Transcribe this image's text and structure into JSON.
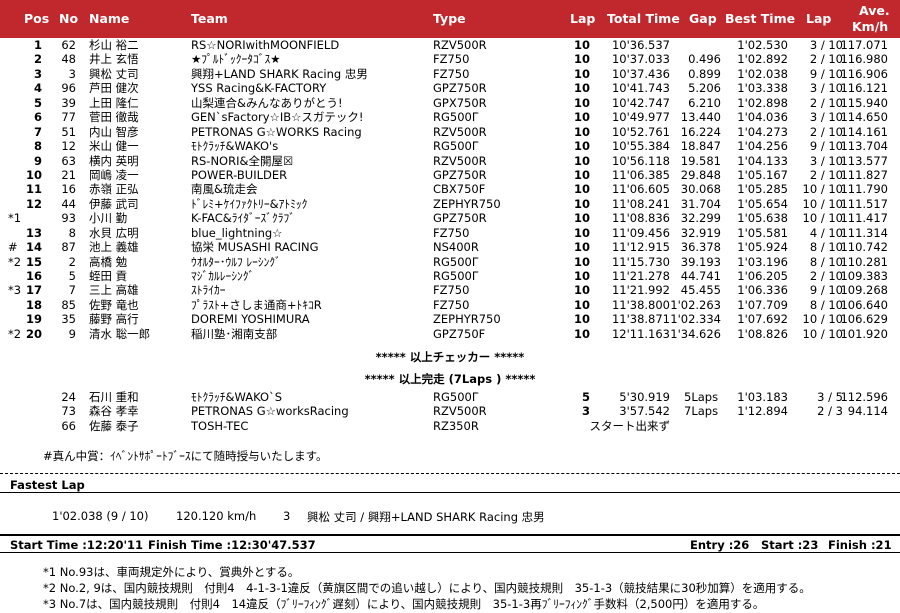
{
  "header": {
    "pos": "Pos",
    "no": "No",
    "name": "Name",
    "team": "Team",
    "type": "Type",
    "lap": "Lap",
    "total_time": "Total Time",
    "gap": "Gap",
    "best_time": "Best Time",
    "best_lap": "Lap",
    "ave_line1": "Ave.",
    "ave_line2": "Km/h"
  },
  "results": [
    {
      "mark": "",
      "pos": "1",
      "no": "62",
      "name": "杉山 裕二",
      "team": "RS☆NORIwithMOONFIELD",
      "type": "RZV500R",
      "lap": "10",
      "total": "10'36.537",
      "gap": "",
      "best": "1'02.530",
      "blap": "3 / 10",
      "ave": "117.071"
    },
    {
      "mark": "",
      "pos": "2",
      "no": "48",
      "name": "井上 玄悟",
      "team": "★ﾌﾟﾙﾄﾞｯｸｰﾀｺﾞｽ★",
      "type": "FZ750",
      "lap": "10",
      "total": "10'37.033",
      "gap": "0.496",
      "best": "1'02.892",
      "blap": "2 / 10",
      "ave": "116.980"
    },
    {
      "mark": "",
      "pos": "3",
      "no": "3",
      "name": "興松 丈司",
      "team": "興翔+LAND SHARK Racing 忠男",
      "type": "FZ750",
      "lap": "10",
      "total": "10'37.436",
      "gap": "0.899",
      "best": "1'02.038",
      "blap": "9 / 10",
      "ave": "116.906"
    },
    {
      "mark": "",
      "pos": "4",
      "no": "96",
      "name": "芦田 健次",
      "team": "YSS Racing&K-FACTORY",
      "type": "GPZ750R",
      "lap": "10",
      "total": "10'41.743",
      "gap": "5.206",
      "best": "1'03.338",
      "blap": "3 / 10",
      "ave": "116.121"
    },
    {
      "mark": "",
      "pos": "5",
      "no": "39",
      "name": "上田 隆仁",
      "team": "山梨連合&みんなありがとう!",
      "type": "GPX750R",
      "lap": "10",
      "total": "10'42.747",
      "gap": "6.210",
      "best": "1'02.898",
      "blap": "2 / 10",
      "ave": "115.940"
    },
    {
      "mark": "",
      "pos": "6",
      "no": "77",
      "name": "菅田 徹哉",
      "team": "GEN`sFactory☆IB☆スガテック!",
      "type": "RG500Γ",
      "lap": "10",
      "total": "10'49.977",
      "gap": "13.440",
      "best": "1'04.036",
      "blap": "3 / 10",
      "ave": "114.650"
    },
    {
      "mark": "",
      "pos": "7",
      "no": "51",
      "name": "内山 智彦",
      "team": "PETRONAS G☆WORKS Racing",
      "type": "RZV500R",
      "lap": "10",
      "total": "10'52.761",
      "gap": "16.224",
      "best": "1'04.273",
      "blap": "2 / 10",
      "ave": "114.161"
    },
    {
      "mark": "",
      "pos": "8",
      "no": "12",
      "name": "米山 健一",
      "team": "ﾓﾄｸﾗｯﾁ&WAKO's",
      "type": "RG500Γ",
      "lap": "10",
      "total": "10'55.384",
      "gap": "18.847",
      "best": "1'04.256",
      "blap": "9 / 10",
      "ave": "113.704"
    },
    {
      "mark": "",
      "pos": "9",
      "no": "63",
      "name": "横内 英明",
      "team": "RS-NORI&全開屋☒",
      "type": "RZV500R",
      "lap": "10",
      "total": "10'56.118",
      "gap": "19.581",
      "best": "1'04.133",
      "blap": "3 / 10",
      "ave": "113.577"
    },
    {
      "mark": "",
      "pos": "10",
      "no": "21",
      "name": "岡嶋 凌一",
      "team": "POWER-BUILDER",
      "type": "GPZ750R",
      "lap": "10",
      "total": "11'06.385",
      "gap": "29.848",
      "best": "1'05.167",
      "blap": "2 / 10",
      "ave": "111.827"
    },
    {
      "mark": "",
      "pos": "11",
      "no": "16",
      "name": "赤嶺 正弘",
      "team": "南風&琉走会",
      "type": "CBX750F",
      "lap": "10",
      "total": "11'06.605",
      "gap": "30.068",
      "best": "1'05.285",
      "blap": "10 / 10",
      "ave": "111.790"
    },
    {
      "mark": "",
      "pos": "12",
      "no": "44",
      "name": "伊藤 武司",
      "team": "ﾄﾞﾚﾐ+ｹｲﾌｧｸﾄﾘｰ&ｱﾄﾐｯｸ",
      "type": "ZEPHYR750",
      "lap": "10",
      "total": "11'08.241",
      "gap": "31.704",
      "best": "1'05.654",
      "blap": "10 / 10",
      "ave": "111.517"
    },
    {
      "mark": "*1",
      "pos": "",
      "no": "93",
      "name": "小川 勤",
      "team": "K-FAC&ﾗｲﾀﾞｰｽﾞｸﾗﾌﾞ",
      "type": "GPZ750R",
      "lap": "10",
      "total": "11'08.836",
      "gap": "32.299",
      "best": "1'05.638",
      "blap": "10 / 10",
      "ave": "111.417"
    },
    {
      "mark": "",
      "pos": "13",
      "no": "8",
      "name": "水貝 広明",
      "team": "blue_lightning☆",
      "type": "FZ750",
      "lap": "10",
      "total": "11'09.456",
      "gap": "32.919",
      "best": "1'05.581",
      "blap": "4 / 10",
      "ave": "111.314"
    },
    {
      "mark": "#",
      "pos": "14",
      "no": "87",
      "name": "池上 義雄",
      "team": "協栄 MUSASHI RACING",
      "type": "NS400R",
      "lap": "10",
      "total": "11'12.915",
      "gap": "36.378",
      "best": "1'05.924",
      "blap": "8 / 10",
      "ave": "110.742"
    },
    {
      "mark": "*2",
      "pos": "15",
      "no": "2",
      "name": "高橋 勉",
      "team": "ｳｵﾙﾀｰ･ｳﾙﾌ ﾚｰｼﾝｸﾞ",
      "type": "RG500Γ",
      "lap": "10",
      "total": "11'15.730",
      "gap": "39.193",
      "best": "1'03.196",
      "blap": "8 / 10",
      "ave": "110.281"
    },
    {
      "mark": "",
      "pos": "16",
      "no": "5",
      "name": "蛭田 貢",
      "team": "ﾏｼﾞｶﾙﾚｰｼﾝｸﾞ",
      "type": "RG500Γ",
      "lap": "10",
      "total": "11'21.278",
      "gap": "44.741",
      "best": "1'06.205",
      "blap": "2 / 10",
      "ave": "109.383"
    },
    {
      "mark": "*3",
      "pos": "17",
      "no": "7",
      "name": "三上 高雄",
      "team": "ｽﾄﾗｲｶｰ",
      "type": "FZ750",
      "lap": "10",
      "total": "11'21.992",
      "gap": "45.455",
      "best": "1'06.336",
      "blap": "9 / 10",
      "ave": "109.268"
    },
    {
      "mark": "",
      "pos": "18",
      "no": "85",
      "name": "佐野 竜也",
      "team": "ﾌﾟﾗｽﾄ+さしま通商+ﾄｷｺR",
      "type": "FZ750",
      "lap": "10",
      "total": "11'38.800",
      "gap": "1'02.263",
      "best": "1'07.709",
      "blap": "8 / 10",
      "ave": "106.640"
    },
    {
      "mark": "",
      "pos": "19",
      "no": "35",
      "name": "藤野 高行",
      "team": "DOREMI YOSHIMURA",
      "type": "ZEPHYR750",
      "lap": "10",
      "total": "11'38.871",
      "gap": "1'02.334",
      "best": "1'07.692",
      "blap": "10 / 10",
      "ave": "106.629"
    },
    {
      "mark": "*2",
      "pos": "20",
      "no": "9",
      "name": "清水 聡一郎",
      "team": "稲川塾･湘南支部",
      "type": "GPZ750F",
      "lap": "10",
      "total": "12'11.163",
      "gap": "1'34.626",
      "best": "1'08.826",
      "blap": "10 / 10",
      "ave": "101.920"
    }
  ],
  "checker_msg": "***** 以上チェッカー *****",
  "finish_msg": "***** 以上完走 (7Laps ) *****",
  "dnf": [
    {
      "no": "24",
      "name": "石川 重和",
      "team": "ﾓﾄｸﾗｯﾁ&WAKO`S",
      "type": "RG500Γ",
      "lap": "5",
      "total": "5'30.919",
      "gap": "5Laps",
      "best": "1'03.183",
      "blap": "3 / 5",
      "ave": "112.596"
    },
    {
      "no": "73",
      "name": "森谷 孝幸",
      "team": "PETRONAS G☆worksRacing",
      "type": "RZV500R",
      "lap": "3",
      "total": "3'57.542",
      "gap": "7Laps",
      "best": "1'12.894",
      "blap": "2 / 3",
      "ave": "94.114"
    },
    {
      "no": "66",
      "name": "佐藤 泰子",
      "team": "TOSH-TEC",
      "type": "RZ350R",
      "lap": "",
      "total": "スタート出来ず",
      "gap": "",
      "best": "",
      "blap": "",
      "ave": ""
    }
  ],
  "prize_note": "#真ん中賞：ｲﾍﾞﾝﾄｻﾎﾟｰﾄﾌﾞｰｽにて随時授与いたします。",
  "fastest": {
    "title": "Fastest Lap",
    "time": "1'02.038 (9 / 10)",
    "speed": "120.120 km/h",
    "no": "3",
    "who": "興松 丈司 / 興翔+LAND SHARK Racing 忠男"
  },
  "footer": {
    "start_time": "Start Time :12:20'11",
    "finish_time": "Finish Time :12:30'47.537",
    "entry": "Entry :26",
    "start": "Start :23",
    "finish": "Finish :21"
  },
  "notes": [
    "*1 No.93は、車両規定外により、賞典外とする。",
    "*2 No.2, 9は、国内競技規則　付則4　4-1-3-1違反（黄旗区間での追い越し）により、国内競技規則　35-1-3（競技結果に30秒加算）を適用する。",
    "*3 No.7は、国内競技規則　付則4　14違反（ﾌﾞﾘｰﾌｨﾝｸﾞ遅刻）により、国内競技規則　35-1-3再ﾌﾞﾘｰﾌｨﾝｸﾞ手数料（2,500円）を適用する。"
  ],
  "colors": {
    "header_bg": "#c0282d",
    "header_text": "#ffffff"
  }
}
